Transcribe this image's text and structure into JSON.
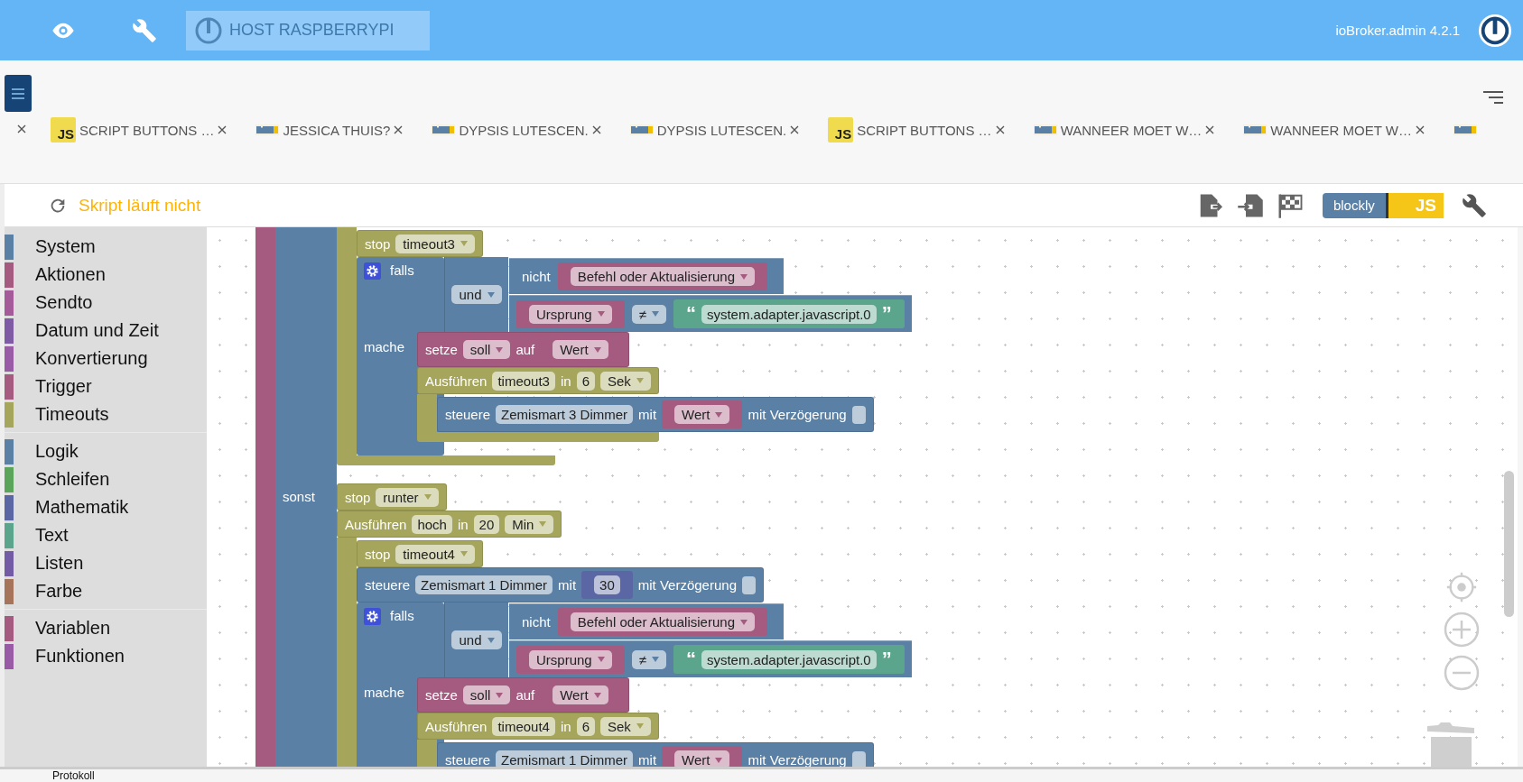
{
  "header": {
    "host": "HOST RASPBERRYPI",
    "version": "ioBroker.admin 4.2.1"
  },
  "tabs": [
    {
      "kind": "js",
      "badge": "JS",
      "label": "SCRIPT BUTTONS …"
    },
    {
      "kind": "blockly",
      "label": "JESSICA THUIS?"
    },
    {
      "kind": "blockly",
      "label": "DYPSIS LUTESCEN."
    },
    {
      "kind": "blockly",
      "label": "DYPSIS LUTESCEN."
    },
    {
      "kind": "js",
      "badge": "JS",
      "label": "SCRIPT BUTTONS …"
    },
    {
      "kind": "blockly",
      "label": "WANNEER MOET W…"
    },
    {
      "kind": "blockly",
      "label": "WANNEER MOET W…"
    },
    {
      "kind": "blockly"
    }
  ],
  "toolbar": {
    "status": "Skript läuft nicht",
    "toggle": {
      "left": "blockly",
      "right": "JS"
    }
  },
  "sidebar": {
    "groups": [
      {
        "items": [
          {
            "label": "System",
            "color": "#5b80a5"
          },
          {
            "label": "Aktionen",
            "color": "#a55b80"
          },
          {
            "label": "Sendto",
            "color": "#a55b99"
          },
          {
            "label": "Datum und Zeit",
            "color": "#805ba5"
          },
          {
            "label": "Konvertierung",
            "color": "#995ba5"
          },
          {
            "label": "Trigger",
            "color": "#a55b80"
          },
          {
            "label": "Timeouts",
            "color": "#a5a55b"
          }
        ]
      },
      {
        "items": [
          {
            "label": "Logik",
            "color": "#5b80a5"
          },
          {
            "label": "Schleifen",
            "color": "#5ba55b"
          },
          {
            "label": "Mathematik",
            "color": "#5b67a5"
          },
          {
            "label": "Text",
            "color": "#5ba58c"
          },
          {
            "label": "Listen",
            "color": "#745ba5"
          },
          {
            "label": "Farbe",
            "color": "#a5745b"
          }
        ]
      },
      {
        "items": [
          {
            "label": "Variablen",
            "color": "#a55b80"
          },
          {
            "label": "Funktionen",
            "color": "#995ba5"
          }
        ]
      }
    ]
  },
  "workspace": {
    "spine": {
      "color": "#a55b80"
    },
    "color": "#5b80a5",
    "branches": [
      {
        "blocks": [
          {
            "kind": "c_block",
            "color": "#a5a55b",
            "children": [
              {
                "kind": "statement",
                "color": "#a5a55b",
                "fields": [
                  {
                    "kind": "label",
                    "text": "stop"
                  },
                  {
                    "kind": "dropdown",
                    "text": "timeout3"
                  }
                ]
              },
              {
                "kind": "if",
                "color": "#5b80a5",
                "label": "falls",
                "do_label": "mache",
                "condition": {
                  "kind": "logic_op",
                  "color": "#5b80a5",
                  "operator": "und",
                  "inputs": [
                    {
                      "color": "#5b80a5",
                      "fields": [
                        {
                          "kind": "label",
                          "text": "nicht"
                        },
                        {
                          "kind": "value",
                          "color": "#a55b80",
                          "fields": [
                            {
                              "kind": "dropdown",
                              "text": "Befehl oder Aktualisierung"
                            }
                          ]
                        }
                      ]
                    },
                    {
                      "color": "#5b80a5",
                      "fields": [
                        {
                          "kind": "value",
                          "color": "#a55b80",
                          "fields": [
                            {
                              "kind": "dropdown",
                              "text": "Ursprung"
                            }
                          ]
                        },
                        {
                          "kind": "dropdown",
                          "text": "≠"
                        },
                        {
                          "kind": "value",
                          "color": "#5ba58c",
                          "fields": [
                            {
                              "kind": "quote",
                              "text": "“"
                            },
                            {
                              "kind": "input",
                              "text": "system.adapter.javascript.0"
                            },
                            {
                              "kind": "quote",
                              "text": "”"
                            }
                          ]
                        }
                      ]
                    }
                  ]
                },
                "children": [
                  {
                    "kind": "statement",
                    "color": "#a55b80",
                    "fields": [
                      {
                        "kind": "label",
                        "text": "setze"
                      },
                      {
                        "kind": "dropdown",
                        "text": "soll"
                      },
                      {
                        "kind": "label",
                        "text": "auf"
                      },
                      {
                        "kind": "value",
                        "color": "#a55b80",
                        "fields": [
                          {
                            "kind": "dropdown",
                            "text": "Wert"
                          }
                        ]
                      }
                    ]
                  },
                  {
                    "kind": "c_block",
                    "color": "#a5a55b",
                    "fields": [
                      {
                        "kind": "label",
                        "text": "Ausführen"
                      },
                      {
                        "kind": "input",
                        "text": "timeout3"
                      },
                      {
                        "kind": "label",
                        "text": "in"
                      },
                      {
                        "kind": "input",
                        "text": "6"
                      },
                      {
                        "kind": "dropdown",
                        "text": "Sek"
                      }
                    ],
                    "children": [
                      {
                        "kind": "statement",
                        "color": "#5b80a5",
                        "fields": [
                          {
                            "kind": "label",
                            "text": "steuere"
                          },
                          {
                            "kind": "input",
                            "text": "Zemismart 3  Dimmer"
                          },
                          {
                            "kind": "label",
                            "text": "mit"
                          },
                          {
                            "kind": "value",
                            "color": "#a55b80",
                            "fields": [
                              {
                                "kind": "dropdown",
                                "text": "Wert"
                              }
                            ]
                          },
                          {
                            "kind": "label",
                            "text": "mit Verzögerung"
                          },
                          {
                            "kind": "checkbox",
                            "checked": false
                          }
                        ]
                      }
                    ]
                  }
                ]
              }
            ]
          }
        ]
      },
      {
        "label": "sonst",
        "blocks": [
          {
            "kind": "statement",
            "color": "#a5a55b",
            "fields": [
              {
                "kind": "label",
                "text": "stop"
              },
              {
                "kind": "dropdown",
                "text": "runter"
              }
            ]
          },
          {
            "kind": "c_block",
            "color": "#a5a55b",
            "fields": [
              {
                "kind": "label",
                "text": "Ausführen"
              },
              {
                "kind": "input",
                "text": "hoch"
              },
              {
                "kind": "label",
                "text": "in"
              },
              {
                "kind": "input",
                "text": "20"
              },
              {
                "kind": "dropdown",
                "text": "Min"
              }
            ],
            "children": [
              {
                "kind": "statement",
                "color": "#a5a55b",
                "fields": [
                  {
                    "kind": "label",
                    "text": "stop"
                  },
                  {
                    "kind": "dropdown",
                    "text": "timeout4"
                  }
                ]
              },
              {
                "kind": "statement",
                "color": "#5b80a5",
                "fields": [
                  {
                    "kind": "label",
                    "text": "steuere"
                  },
                  {
                    "kind": "input",
                    "text": "Zemismart 1  Dimmer"
                  },
                  {
                    "kind": "label",
                    "text": "mit"
                  },
                  {
                    "kind": "value",
                    "color": "#5b67a5",
                    "fields": [
                      {
                        "kind": "input",
                        "text": "30"
                      }
                    ]
                  },
                  {
                    "kind": "label",
                    "text": "mit Verzögerung"
                  },
                  {
                    "kind": "checkbox",
                    "checked": false
                  }
                ]
              },
              {
                "kind": "if",
                "color": "#5b80a5",
                "label": "falls",
                "do_label": "mache",
                "condition": {
                  "kind": "logic_op",
                  "color": "#5b80a5",
                  "operator": "und",
                  "inputs": [
                    {
                      "color": "#5b80a5",
                      "fields": [
                        {
                          "kind": "label",
                          "text": "nicht"
                        },
                        {
                          "kind": "value",
                          "color": "#a55b80",
                          "fields": [
                            {
                              "kind": "dropdown",
                              "text": "Befehl oder Aktualisierung"
                            }
                          ]
                        }
                      ]
                    },
                    {
                      "color": "#5b80a5",
                      "fields": [
                        {
                          "kind": "value",
                          "color": "#a55b80",
                          "fields": [
                            {
                              "kind": "dropdown",
                              "text": "Ursprung"
                            }
                          ]
                        },
                        {
                          "kind": "dropdown",
                          "text": "≠"
                        },
                        {
                          "kind": "value",
                          "color": "#5ba58c",
                          "fields": [
                            {
                              "kind": "quote",
                              "text": "“"
                            },
                            {
                              "kind": "input",
                              "text": "system.adapter.javascript.0"
                            },
                            {
                              "kind": "quote",
                              "text": "”"
                            }
                          ]
                        }
                      ]
                    }
                  ]
                },
                "children": [
                  {
                    "kind": "statement",
                    "color": "#a55b80",
                    "fields": [
                      {
                        "kind": "label",
                        "text": "setze"
                      },
                      {
                        "kind": "dropdown",
                        "text": "soll"
                      },
                      {
                        "kind": "label",
                        "text": "auf"
                      },
                      {
                        "kind": "value",
                        "color": "#a55b80",
                        "fields": [
                          {
                            "kind": "dropdown",
                            "text": "Wert"
                          }
                        ]
                      }
                    ]
                  },
                  {
                    "kind": "c_block",
                    "color": "#a5a55b",
                    "fields": [
                      {
                        "kind": "label",
                        "text": "Ausführen"
                      },
                      {
                        "kind": "input",
                        "text": "timeout4"
                      },
                      {
                        "kind": "label",
                        "text": "in"
                      },
                      {
                        "kind": "input",
                        "text": "6"
                      },
                      {
                        "kind": "dropdown",
                        "text": "Sek"
                      }
                    ],
                    "children": [
                      {
                        "kind": "statement",
                        "color": "#5b80a5",
                        "fields": [
                          {
                            "kind": "label",
                            "text": "steuere"
                          },
                          {
                            "kind": "input",
                            "text": "Zemismart 1  Dimmer"
                          },
                          {
                            "kind": "label",
                            "text": "mit"
                          },
                          {
                            "kind": "value",
                            "color": "#a55b80",
                            "fields": [
                              {
                                "kind": "dropdown",
                                "text": "Wert"
                              }
                            ]
                          },
                          {
                            "kind": "label",
                            "text": "mit Verzögerung"
                          },
                          {
                            "kind": "checkbox",
                            "checked": false
                          }
                        ]
                      }
                    ]
                  }
                ]
              }
            ]
          }
        ]
      }
    ]
  },
  "footer": {
    "tab": "Protokoll"
  }
}
